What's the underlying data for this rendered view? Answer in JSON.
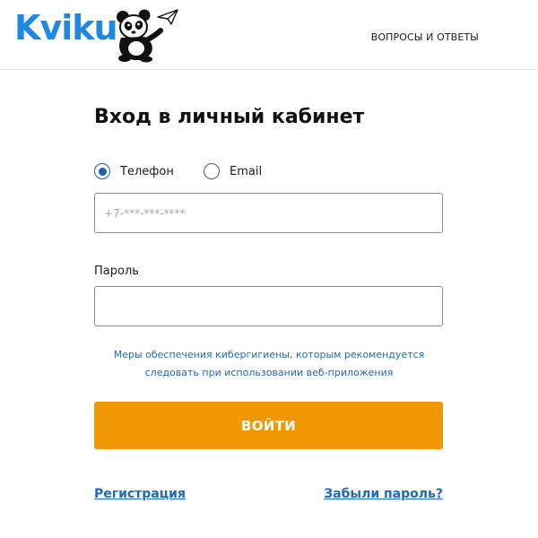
{
  "header": {
    "logo_text": "Kviku",
    "faq_link": "ВОПРОСЫ И ОТВЕТЫ"
  },
  "login": {
    "title": "Вход в личный кабинет",
    "methods": [
      {
        "label": "Телефон",
        "selected": true
      },
      {
        "label": "Email",
        "selected": false
      }
    ],
    "phone_placeholder": "+7-***-***-****",
    "phone_value": "",
    "password_label": "Пароль",
    "password_value": "",
    "security_note": "Меры обеспечения кибергигиены, которым рекомендуется следовать при использовании веб-приложения",
    "submit_label": "ВОЙТИ",
    "register_link": "Регистрация",
    "forgot_link": "Забыли пароль?"
  },
  "colors": {
    "brand_blue": "#1e88e5",
    "link_blue": "#1f6bb5",
    "radio_blue": "#1e5fb3",
    "button_orange": "#f29704"
  },
  "icons": {
    "logo_mascot": "panda-icon",
    "logo_accent": "paper-plane-icon"
  }
}
